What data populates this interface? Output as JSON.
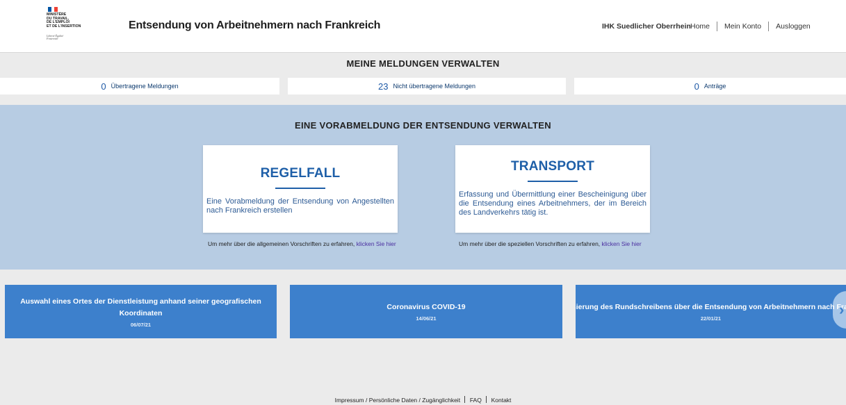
{
  "colors": {
    "accent": "#1e5fa8",
    "band_background": "#b7cce3",
    "tile_background": "#3d80cc",
    "page_background": "#ebebeb",
    "flag_blue": "#0055a4",
    "flag_red": "#ef4135"
  },
  "header": {
    "logo": {
      "text_lines": [
        "MINISTÈRE",
        "DU TRAVAIL,",
        "DE L'EMPLOI",
        "ET DE L'INSERTION"
      ],
      "motto": "Liberté Égalité Fraternité"
    },
    "title": "Entsendung von Arbeitnehmern nach Frankreich",
    "user": "IHK Suedlicher Oberrhein",
    "nav": {
      "home": "Home",
      "account": "Mein Konto",
      "logout": "Ausloggen"
    }
  },
  "meldungen": {
    "title": "MEINE MELDUNGEN VERWALTEN",
    "items": [
      {
        "count": "0",
        "label": "Übertragene Meldungen"
      },
      {
        "count": "23",
        "label": "Nicht übertragene Meldungen"
      },
      {
        "count": "0",
        "label": "Anträge"
      }
    ]
  },
  "vorabmeldung": {
    "title": "EINE VORABMELDUNG DER ENTSENDUNG VERWALTEN",
    "cards": [
      {
        "title": "REGELFALL",
        "text": "Eine Vorabmeldung der Entsendung von Angestellten nach Frankreich erstellen",
        "more_text": "Um mehr über die allgemeinen Vorschriften zu erfahren,",
        "more_link": "klicken Sie hier"
      },
      {
        "title": "TRANSPORT",
        "text": "Erfassung und Übermittlung einer Bescheinigung über die Entsendung eines Arbeitnehmers, der im Bereich des Landverkehrs tätig ist.",
        "more_text": "Um mehr über die speziellen Vorschriften zu erfahren,",
        "more_link": "klicken Sie hier"
      }
    ]
  },
  "news": [
    {
      "title": "Auswahl eines Ortes der Dienstleistung anhand seiner geografischen Koordinaten",
      "date": "06/07/21"
    },
    {
      "title": "Coronavirus COVID-19",
      "date": "14/06/21"
    },
    {
      "title": "Aktualisierung des Rundschreibens über die Entsendung von Arbeitnehmern nach Frankreich",
      "date": "22/01/21"
    }
  ],
  "carousel": {
    "next_icon": "chevron-right-icon",
    "glyph": "›"
  },
  "footer": {
    "links_text": "Impressum / Persönliche Daten / Zugänglichkeit",
    "faq": "FAQ",
    "contact": "Kontakt"
  }
}
